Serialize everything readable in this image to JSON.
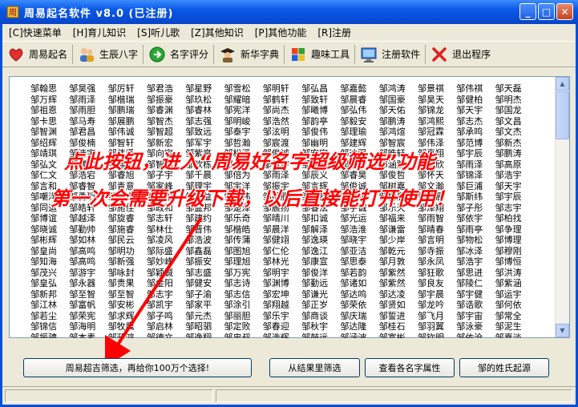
{
  "window": {
    "title": "周易起名软件 v8.0 (已注册)"
  },
  "menu": [
    "[C]快速菜单",
    "[H]育儿知识",
    "[S]听儿歌",
    "[Z]其他知识",
    "[P]其他功能",
    "[R]注册"
  ],
  "toolbar": [
    {
      "label": "周易起名",
      "icon": "heart-icon"
    },
    {
      "label": "生辰八字",
      "icon": "people-icon"
    },
    {
      "label": "名字评分",
      "icon": "go-arrow-icon"
    },
    {
      "label": "新华字典",
      "icon": "scholar-icon"
    },
    {
      "label": "趣味工具",
      "icon": "windows-icon"
    },
    {
      "label": "注册软件",
      "icon": "monitor-icon"
    },
    {
      "label": "退出程序",
      "icon": "exit-x-icon"
    }
  ],
  "names_columns": [
    [
      "邹翰思",
      "邹万辉",
      "邹祖恩",
      "邹卡思",
      "邹智渊",
      "邹绍辉",
      "邹靖琪",
      "邹弘文",
      "邹仁文",
      "邹言和",
      "邹嘲洋",
      "邹同运",
      "邹博谊",
      "邹晓诚",
      "邹彬辉",
      "邹皇尚",
      "邹知海",
      "邹茂兴",
      "邹皇弘",
      "邹新邦",
      "邹江林",
      "邹若尘",
      "邹锦信",
      "邹振骋",
      "邹涌诚"
    ],
    [
      "邹昊强",
      "邹雨泽",
      "邹雨胆",
      "邹马寿",
      "邹君昌",
      "邹俊楠",
      "邹浩宇",
      "邹博文",
      "邹浩宕",
      "邹睿智",
      "邹勇珩",
      "邹皓轩",
      "邹越泽",
      "邹勤帅",
      "邹如林",
      "邹高鸣",
      "邹高鸣",
      "邹游宇",
      "邹永器",
      "邹至智",
      "邹富帆",
      "邹荣宪",
      "邹海明",
      "邹本素",
      "邹繁林"
    ],
    [
      "邹厉轩",
      "邹楷瑞",
      "邹鹏瑞",
      "邹展鹏",
      "邹伟诚",
      "邹智轩",
      "邹伟泽",
      "邹嘉年",
      "邹睿旭",
      "邹青意",
      "邹锐杰",
      "邹施佳",
      "邹旋睿",
      "邹施睿",
      "邹民云",
      "邹明功",
      "邹新强",
      "邹咏封",
      "邹贵果",
      "邹至智",
      "邹安彬",
      "邹求辉",
      "邹牧鹰",
      "邹政鸿",
      "邹本恭"
    ],
    [
      "邹君浩",
      "邹振豪",
      "邹睿渊",
      "邹智杰",
      "邹智超",
      "邹新宏",
      "邹向宇",
      "邹智明",
      "邹子宇",
      "邹家峰",
      "邹睿柏",
      "邹政和",
      "邹志轩",
      "邹林仕",
      "邹凌风",
      "邹际盛",
      "邹妙峰",
      "邹颖铖",
      "邹金阳",
      "邹志宇",
      "邹凯宇",
      "邹子鸣",
      "邹启林",
      "邹德文",
      "邹保金"
    ],
    [
      "邹星野",
      "邹玖松",
      "邹睿林",
      "邹志强",
      "邹致远",
      "邹军宇",
      "邹紫亭",
      "邹钦栋",
      "邹千晨",
      "邹理宇",
      "邹鑫益",
      "邹益邦",
      "邹建约",
      "邹晋伟",
      "邹浩波",
      "邹鑫磊",
      "邹振安",
      "邹志盛",
      "邹健安",
      "邹子渝",
      "邹家平",
      "邹元杰",
      "邹昭驷",
      "邹逸翔",
      "邹森申"
    ],
    [
      "邹雪松",
      "邹耀暗",
      "邹宪洋",
      "邹明峻",
      "邹泰宇",
      "邹哲瀚",
      "邹松溪",
      "邹小颖",
      "邹倍为",
      "邹宇洋",
      "邹纪伟",
      "邹楚泽",
      "邹乐奇",
      "邹楷皓",
      "邹传蒲",
      "邹图旭",
      "邹理旭",
      "邹万宪",
      "邹志诗",
      "邹志信",
      "邹涂引",
      "邹丽胆",
      "邹定败",
      "邹忠叔",
      "邹习安"
    ],
    [
      "邹明轩",
      "邹鹤轩",
      "邹尚杰",
      "邹浩然",
      "邹泫明",
      "邹宸渡",
      "邹俊诚",
      "邹俊宇",
      "邹雨泽",
      "邹振宇",
      "邹振胆",
      "邹晨扬",
      "邹晴川",
      "邹晨洋",
      "邹健翊",
      "邹仁伦",
      "邹林光",
      "邹明宇",
      "邹渊博",
      "邹宏坤",
      "邹翔越",
      "邹乐宇",
      "邹春迎",
      "邹浩辉",
      "邹乐平"
    ],
    [
      "邹弘昌",
      "邹致轩",
      "邹曦博",
      "邹韵亭",
      "邹俊伟",
      "邹幽明",
      "邹宏宇",
      "邹明辉",
      "邹辰义",
      "邹言辉",
      "邹潇然",
      "邹睿泫",
      "邹扣诚",
      "邹解泽",
      "邹逸瑛",
      "邹逸江",
      "邹康宣",
      "邹俊洋",
      "邹勤远",
      "邹谦光",
      "邹正岁",
      "邹商谈",
      "邹秋宇",
      "邹鼓远",
      "邹君春"
    ],
    [
      "邹嘉懿",
      "邹晨睿",
      "邹弘伟",
      "邹毅安",
      "邹理瑜",
      "邹建辉",
      "邹达强",
      "邹浩安",
      "邹睿昊",
      "邹俊诚",
      "邹煜辉",
      "邹宇诚",
      "邹光运",
      "邹浩淮",
      "邹晓宇",
      "邹亚洁",
      "邹思泰",
      "邹若韵",
      "邹诸如",
      "邹达鸣",
      "邹荣依",
      "邹庆瑞",
      "邹达隆",
      "邹涵波",
      "邹树维"
    ],
    [
      "邹鸿涛",
      "邹国豪",
      "邹天佑",
      "邹鹏涛",
      "邹鸿煊",
      "邹智宸",
      "邹皓轩",
      "邹涵煦",
      "邹俊哲",
      "邹树嘉",
      "邹树晨",
      "邹乐天",
      "邹福来",
      "邹谦雷",
      "邹少岸",
      "邹乾元",
      "邹月敦",
      "邹紫然",
      "邹紫然",
      "邹达凌",
      "邹贤如",
      "邹誓进",
      "邹桂石",
      "邹富彬",
      "邹相彤"
    ],
    [
      "邹景祺",
      "邹昊天",
      "邹锦龙",
      "邹鸿熙",
      "邹冠霖",
      "邹伟泽",
      "邹喜翔",
      "邹责欣",
      "邹怀天",
      "邹文瀚",
      "邹轩晨",
      "邹泽翔",
      "邹雨智",
      "邹晴春",
      "邹言明",
      "邹寺振",
      "邹永凤",
      "邹狂歌",
      "邹良友",
      "邹宇晨",
      "邹龙吟",
      "邹飞月",
      "邹羽翼",
      "邹钦明",
      "邹怀玉"
    ],
    [
      "邹伟祺",
      "邹健柏",
      "邹天宇",
      "邹志杰",
      "邹承鸣",
      "邹范博",
      "邹宇辰",
      "邹雨泽",
      "邹锦泽",
      "邹巨浦",
      "邹斯纬",
      "邹子彤",
      "邹依宇",
      "邹雨亭",
      "邹物松",
      "邹冰泽",
      "邹浩宇",
      "邹思进",
      "邹陵仁",
      "邹宇健",
      "邹诰歌",
      "邹宇宙",
      "邹泳豪",
      "邹依沧",
      "邹言访"
    ],
    [
      "邹天磊",
      "邹明杰",
      "邹国龙",
      "邹文昌",
      "邹文杰",
      "邹新杰",
      "邹鹏涛",
      "邹高原",
      "邹浩宇",
      "邹天宇",
      "邹宇辰",
      "邹志宇",
      "邹柏找",
      "邹争理",
      "邹博理",
      "邹穆刚",
      "邹博恒",
      "邹洪涛",
      "邹紫涵",
      "邹运宇",
      "邹何依",
      "邹常全",
      "邹泥生",
      "邹嘉淡",
      "邹丰幽"
    ]
  ],
  "overlay": {
    "line1": "点此按钮，进入“周易好名字超级筛选”功能",
    "line2": "第一次会需要升级下载，以后直接能打开使用！"
  },
  "buttons": {
    "super_filter": "周易超吉筛选，再给你100万个选择!",
    "filter_results": "从结果里筛选",
    "view_attr": "查看各名字属性",
    "surname_origin": "邹的姓氏起源"
  },
  "colors": {
    "accent": "#0a58e8",
    "overlay_text": "#ff0000"
  }
}
